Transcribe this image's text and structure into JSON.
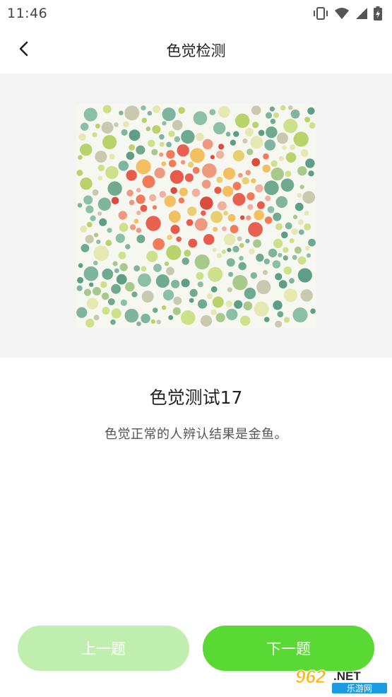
{
  "status_bar": {
    "time": "11:46",
    "icons": [
      "vibrate-icon",
      "wifi-icon",
      "signal-icon",
      "battery-charging-icon"
    ]
  },
  "app_bar": {
    "title": "色觉检测",
    "back_icon": "chevron-left-icon"
  },
  "image": {
    "semantic": "ishihara-color-plate-goldfish"
  },
  "quiz": {
    "title": "色觉测试17",
    "description": "色觉正常的人辨认结果是金鱼。"
  },
  "buttons": {
    "prev_label": "上一题",
    "next_label": "下一题"
  },
  "watermark": {
    "number": "962",
    "suffix": ".NET",
    "caption": "乐游网"
  },
  "colors": {
    "prev_button": "#bfeeae",
    "next_button": "#5ad834",
    "panel_background": "#f3f3f3"
  }
}
